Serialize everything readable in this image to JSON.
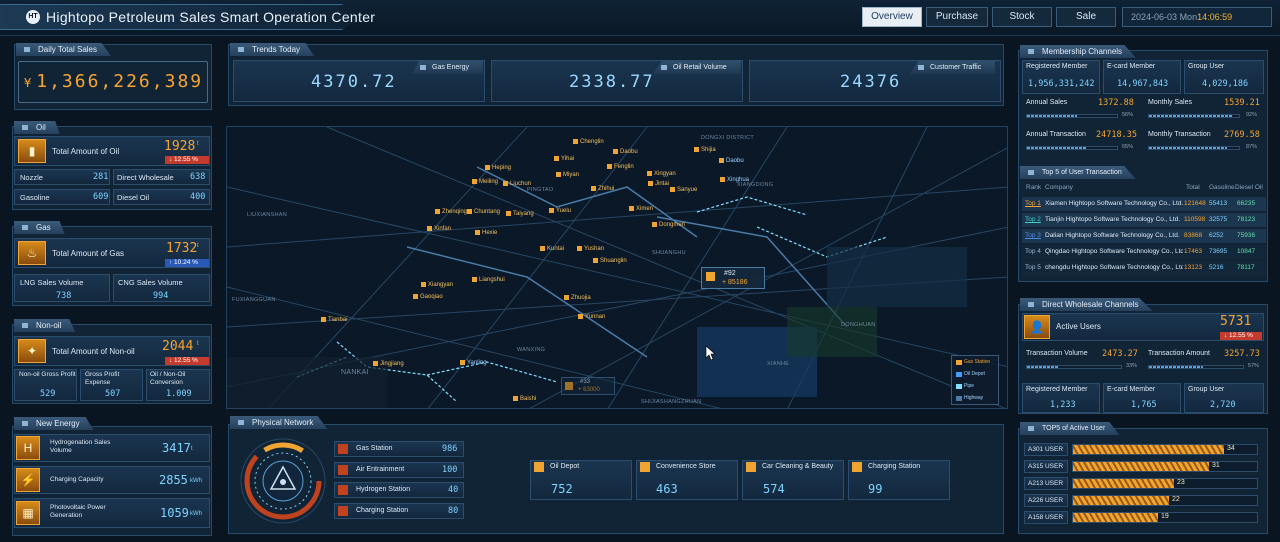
{
  "header": {
    "logo_text": "HT",
    "title": "Hightopo Petroleum Sales Smart Operation Center",
    "nav": [
      "Overview",
      "Purchase",
      "Stock",
      "Sale"
    ],
    "active_nav": "Overview",
    "date": "2024-06-03",
    "weekday": "Mon",
    "time": "14:06:59"
  },
  "daily_sales": {
    "title": "Daily Total Sales",
    "currency": "¥",
    "value": "1,366,226,389"
  },
  "trends": {
    "title": "Trends Today",
    "items": [
      {
        "label": "Gas Energy",
        "value": "4370.72"
      },
      {
        "label": "Oil Retail Volume",
        "value": "2338.77"
      },
      {
        "label": "Customer Traffic",
        "value": "24376"
      }
    ]
  },
  "oil": {
    "title": "Oil",
    "total_label": "Total Amount of Oil",
    "total_value": "1928",
    "unit": "t",
    "change": "↓ 12.55",
    "change_unit": "%",
    "stats": [
      {
        "label": "Nozzle",
        "value": "281"
      },
      {
        "label": "Direct Wholesale",
        "value": "638"
      },
      {
        "label": "Gasoline",
        "value": "609"
      },
      {
        "label": "Diesel Oil",
        "value": "400"
      }
    ]
  },
  "gas": {
    "title": "Gas",
    "total_label": "Total Amount of Gas",
    "total_value": "1732",
    "unit": "t",
    "change": "↑ 10.24",
    "change_unit": "%",
    "stats": [
      {
        "label": "LNG Sales Volume",
        "value": "738"
      },
      {
        "label": "CNG Sales Volume",
        "value": "994"
      }
    ]
  },
  "nonoil": {
    "title": "Non-oil",
    "total_label": "Total Amount of Non-oil",
    "total_value": "2044",
    "unit": "t",
    "change": "↓ 12.55",
    "change_unit": "%",
    "stats": [
      {
        "label": "Non-oil Gross Profit",
        "value": "529"
      },
      {
        "label": "Gross Profit Expense",
        "value": "507"
      },
      {
        "label": "Oil / Non-Oil Conversion",
        "value": "1.009"
      }
    ]
  },
  "new_energy": {
    "title": "New Energy",
    "items": [
      {
        "label": "Hydrogenation Sales Volume",
        "value": "3417",
        "unit": "t"
      },
      {
        "label": "Charging Capacity",
        "value": "2855",
        "unit": "kWh"
      },
      {
        "label": "Photovoltaic Power Generation",
        "value": "1059",
        "unit": "kWh"
      }
    ]
  },
  "map": {
    "labels": [
      "Chenglin",
      "Daobu",
      "Shijia",
      "Yihai",
      "Miyan",
      "Xingyan",
      "Fenglin",
      "Daobu",
      "Meiling",
      "Liuchun",
      "Jintai",
      "Zhenqing",
      "Chuntang",
      "Sanyue",
      "Xinghua",
      "Xinfan",
      "Yuelu",
      "Ximen",
      "Dongmen",
      "Kuntai",
      "Yushan",
      "Hexie",
      "Taiyang",
      "Liangshui",
      "Xiangyan",
      "Gaoqiao",
      "Zhuojia",
      "Shuanglin",
      "Tianbai",
      "Jingjiang",
      "Yanling",
      "Baishi",
      "Yunnan",
      "Heping",
      "Zhihui"
    ],
    "districts": [
      "DONGXI DISTRICT",
      "LIUXIANSHAN",
      "PINGTAO",
      "WANXING",
      "FUXIANGGUAN",
      "XIANGDONG",
      "NANKAI",
      "SHUANGHU",
      "DONGHUAN",
      "SHIJIASHANGZHUAN",
      "XIANHE"
    ],
    "tooltip_title": "#92",
    "tooltip_value": "+ 85186",
    "tooltip2_title": "#33",
    "tooltip2_value": "+ 63000",
    "legend": [
      "Gas Station",
      "Oil Depot",
      "Pipe",
      "Highway"
    ],
    "legend_colors": [
      "#f0a532",
      "#3fa0ff",
      "#7fe0ff",
      "#4a7ca8"
    ]
  },
  "physical": {
    "title": "Physical Network",
    "list": [
      {
        "label": "Gas Station",
        "value": "986"
      },
      {
        "label": "Air Entrainment",
        "value": "100"
      },
      {
        "label": "Hydrogen Station",
        "value": "40"
      },
      {
        "label": "Charging Station",
        "value": "80"
      }
    ],
    "cards": [
      {
        "label": "Oil Depot",
        "value": "752"
      },
      {
        "label": "Convenience Store",
        "value": "463"
      },
      {
        "label": "Car Cleaning & Beauty",
        "value": "574"
      },
      {
        "label": "Charging Station",
        "value": "99"
      }
    ]
  },
  "membership": {
    "title": "Membership Channels",
    "heads": [
      "Registered Member",
      "E-card Member",
      "Group User"
    ],
    "values": [
      "1,956,331,242",
      "14,967,843",
      "4,029,186"
    ],
    "stats": [
      {
        "label": "Annual Sales",
        "value": "1372.88",
        "pct": "56%",
        "fill": 0.56
      },
      {
        "label": "Monthly Sales",
        "value": "1539.21",
        "pct": "92%",
        "fill": 0.92
      },
      {
        "label": "Annual Transaction",
        "value": "24718.35",
        "pct": "65%",
        "fill": 0.65
      },
      {
        "label": "Monthly Transaction",
        "value": "2769.58",
        "pct": "87%",
        "fill": 0.87
      }
    ],
    "top5_title": "Top 5 of User Transaction",
    "top5_cols": [
      "Rank",
      "Company",
      "Total",
      "Gasoline",
      "Diesel Oil"
    ],
    "top5": [
      {
        "rank": "Top 1",
        "company": "Xiamen Hightopo Software Technology Co., Ltd.",
        "total": "121648",
        "gasoline": "55413",
        "diesel": "66235"
      },
      {
        "rank": "Top 2",
        "company": "Tianjin Hightopo Software Technology Co., Ltd.",
        "total": "110598",
        "gasoline": "32575",
        "diesel": "78123"
      },
      {
        "rank": "Top 3",
        "company": "Dalian Hightopo Software Technology Co., Ltd.",
        "total": "83868",
        "gasoline": "6252",
        "diesel": "75936"
      },
      {
        "rank": "Top 4",
        "company": "Qingdao Hightopo Software Technology Co., Ltd.",
        "total": "17463",
        "gasoline": "73695",
        "diesel": "10847"
      },
      {
        "rank": "Top 5",
        "company": "chengdu Hightopo Software Technology Co., Ltd.",
        "total": "13123",
        "gasoline": "5216",
        "diesel": "78117"
      }
    ],
    "rank_colors": [
      "#f6a431",
      "#3fd0c9",
      "#4c8fe0",
      "#9fb4c8",
      "#9fb4c8"
    ]
  },
  "wholesale": {
    "title": "Direct Wholesale Channels",
    "active_label": "Active Users",
    "active_value": "5731",
    "change": "↓ 12.55",
    "change_unit": "%",
    "tx_volume_label": "Transaction Volume",
    "tx_volume_value": "2473.27",
    "tx_volume_pct": "33%",
    "tx_volume_fill": 0.33,
    "tx_amount_label": "Transaction Amount",
    "tx_amount_value": "3257.73",
    "tx_amount_pct": "57%",
    "tx_amount_fill": 0.57,
    "heads": [
      "Registered Member",
      "E-card Member",
      "Group User"
    ],
    "values": [
      "1,233",
      "1,765",
      "2,720"
    ],
    "top_title": "TOP5 of Active User",
    "top": [
      {
        "label": "A301 USER",
        "value": "34",
        "fill": 0.82
      },
      {
        "label": "A315 USER",
        "value": "31",
        "fill": 0.74
      },
      {
        "label": "A213 USER",
        "value": "23",
        "fill": 0.55
      },
      {
        "label": "A226 USER",
        "value": "22",
        "fill": 0.52
      },
      {
        "label": "A158 USER",
        "value": "19",
        "fill": 0.46
      }
    ]
  }
}
